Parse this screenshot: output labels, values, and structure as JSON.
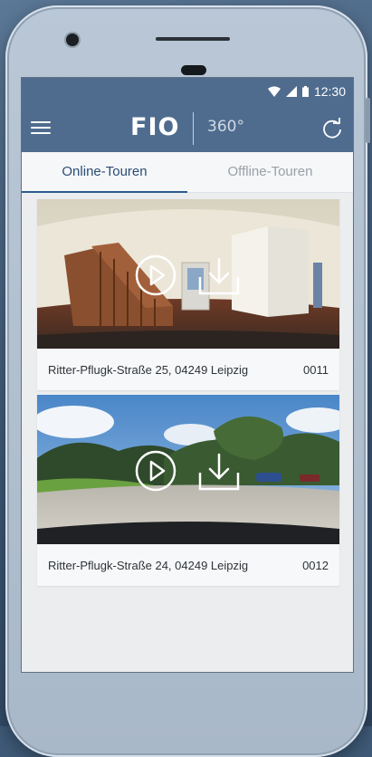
{
  "status_bar": {
    "time": "12:30",
    "wifi_icon": "wifi-icon",
    "signal_icon": "signal-icon",
    "battery_icon": "battery-icon"
  },
  "app_bar": {
    "logo_text": "FIO",
    "logo_suffix": "360°",
    "menu_icon": "hamburger-menu-icon",
    "refresh_icon": "refresh-icon"
  },
  "tabs": [
    {
      "label": "Online-Touren",
      "active": true
    },
    {
      "label": "Offline-Touren",
      "active": false
    }
  ],
  "tours": [
    {
      "address": "Ritter-Pflugk-Straße 25, 04249 Leipzig",
      "id": "0011",
      "scene": "indoor-staircase"
    },
    {
      "address": "Ritter-Pflugk-Straße 24, 04249 Leipzig",
      "id": "0012",
      "scene": "outdoor-street"
    }
  ],
  "colors": {
    "app_bar": "#4f6c8f",
    "active_tab_text": "#2b4d77",
    "tab_indicator": "#2b5b8f"
  }
}
